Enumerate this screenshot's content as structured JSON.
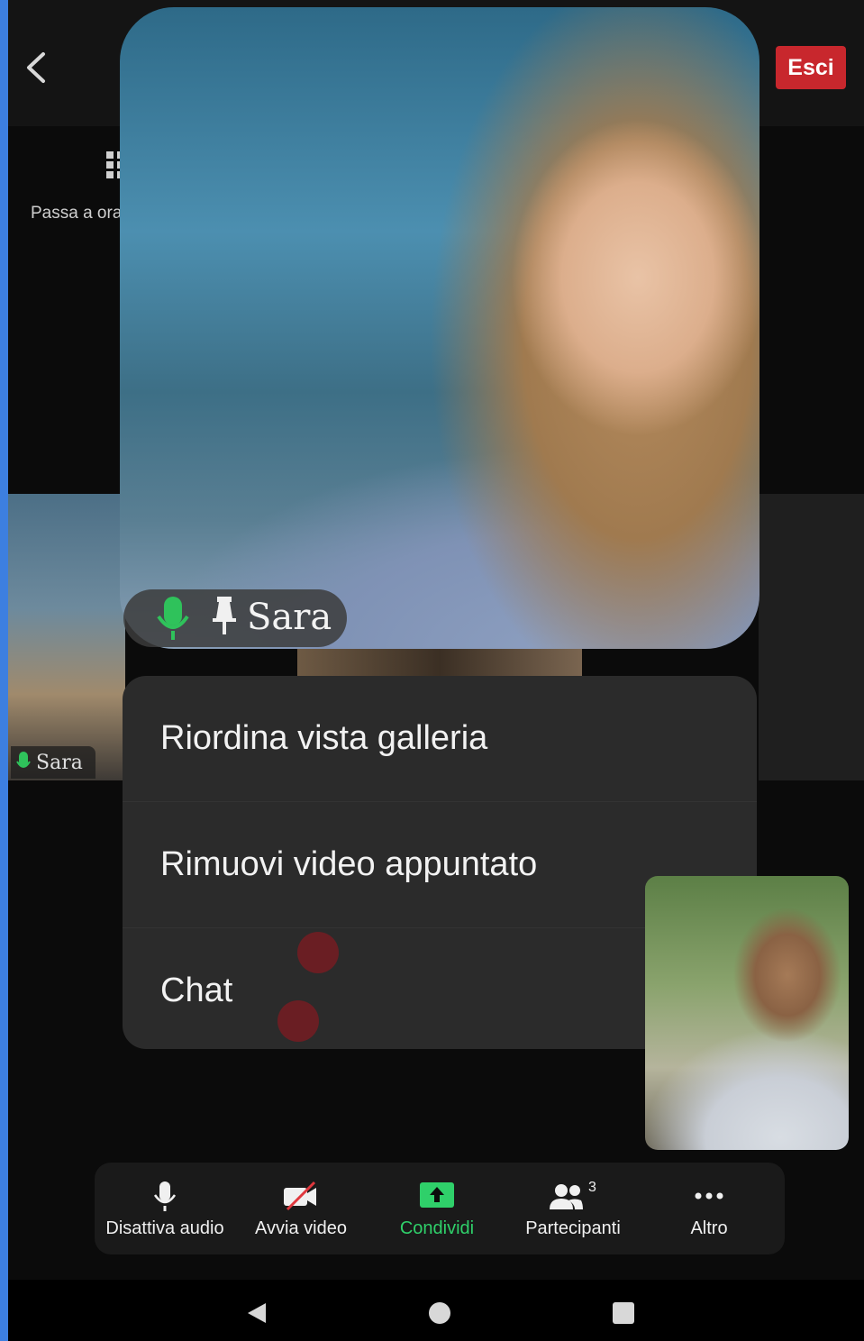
{
  "top_bar": {
    "leave_label": "Esci",
    "switch_view_label": "Passa a ora"
  },
  "gallery": {
    "left_tile_name": "Sara"
  },
  "pinned_video": {
    "participant_name": "Sara"
  },
  "context_menu": {
    "items": [
      {
        "label": "Riordina vista galleria"
      },
      {
        "label": "Rimuovi video appuntato"
      },
      {
        "label": "Chat"
      }
    ]
  },
  "toolbar": {
    "mute_label": "Disattiva audio",
    "video_label": "Avvia video",
    "share_label": "Condividi",
    "participants_label": "Partecipanti",
    "participants_count": "3",
    "more_label": "Altro"
  },
  "colors": {
    "leave": "#c8272d",
    "share_green": "#2fd06a",
    "menu_bg": "#2b2b2b",
    "mic_green": "#2fc25b"
  }
}
